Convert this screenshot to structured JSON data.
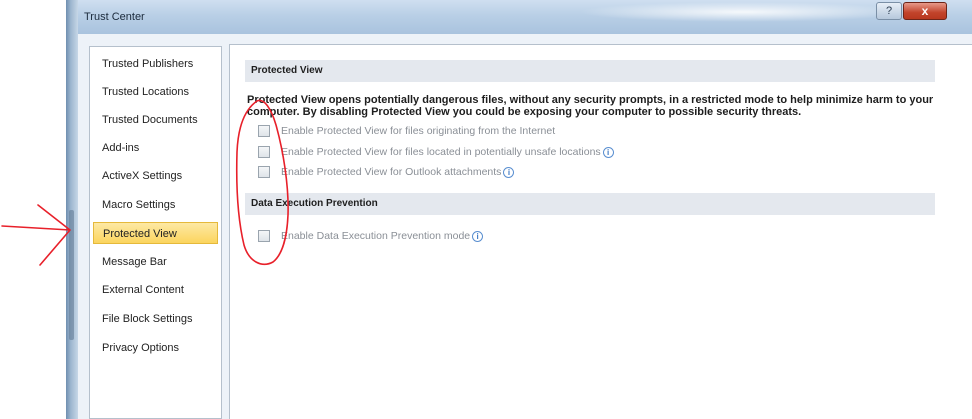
{
  "window": {
    "title": "Trust Center",
    "help_glyph": "?",
    "close_glyph": "x"
  },
  "nav": {
    "items": [
      {
        "label": "Trusted Publishers",
        "selected": false
      },
      {
        "label": "Trusted Locations",
        "selected": false
      },
      {
        "label": "Trusted Documents",
        "selected": false
      },
      {
        "label": "Add-ins",
        "selected": false
      },
      {
        "label": "ActiveX Settings",
        "selected": false
      },
      {
        "label": "Macro Settings",
        "selected": false
      },
      {
        "label": "Protected View",
        "selected": true
      },
      {
        "label": "Message Bar",
        "selected": false
      },
      {
        "label": "External Content",
        "selected": false
      },
      {
        "label": "File Block Settings",
        "selected": false
      },
      {
        "label": "Privacy Options",
        "selected": false
      }
    ]
  },
  "protected_view": {
    "header": "Protected View",
    "description": "Protected View opens potentially dangerous files, without any security prompts, in a restricted mode to help minimize harm to your computer. By disabling Protected View you could be exposing your computer to possible security threats.",
    "options": [
      {
        "label": "Enable Protected View for files originating from the Internet",
        "checked": false,
        "info": false
      },
      {
        "label": "Enable Protected View for files located in potentially unsafe locations",
        "checked": false,
        "info": true
      },
      {
        "label": "Enable Protected View for Outlook attachments",
        "checked": false,
        "info": true
      }
    ]
  },
  "dep": {
    "header": "Data Execution Prevention",
    "options": [
      {
        "label": "Enable Data Execution Prevention mode",
        "checked": false,
        "info": true
      }
    ]
  },
  "icons": {
    "info": "info-icon",
    "info_glyph": "i"
  },
  "colors": {
    "selected_bg": "#fbd55e",
    "annotation": "#e8202a",
    "close_button": "#c2432b"
  }
}
